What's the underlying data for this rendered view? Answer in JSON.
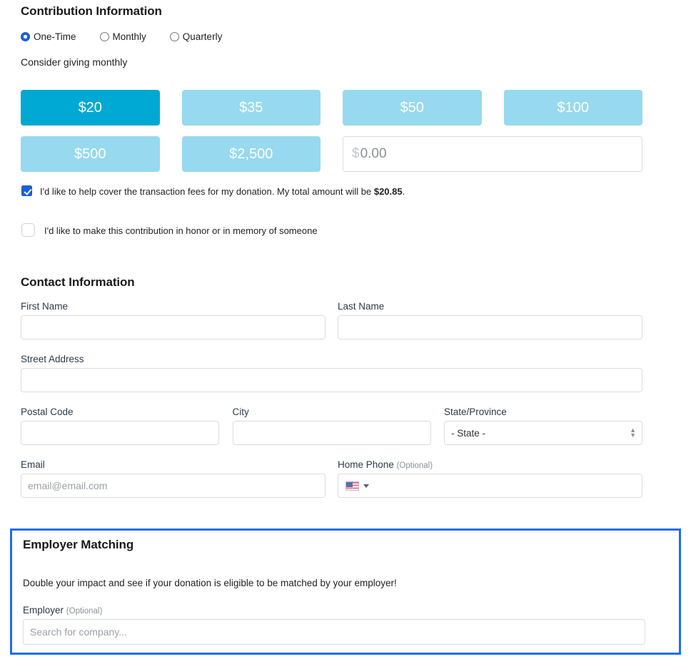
{
  "contribution": {
    "title": "Contribution Information",
    "frequency_options": [
      {
        "label": "One-Time",
        "selected": true
      },
      {
        "label": "Monthly",
        "selected": false
      },
      {
        "label": "Quarterly",
        "selected": false
      }
    ],
    "consider_text": "Consider giving monthly",
    "amounts": [
      {
        "label": "$20",
        "selected": true
      },
      {
        "label": "$35",
        "selected": false
      },
      {
        "label": "$50",
        "selected": false
      },
      {
        "label": "$100",
        "selected": false
      },
      {
        "label": "$500",
        "selected": false
      },
      {
        "label": "$2,500",
        "selected": false
      }
    ],
    "custom_amount": {
      "currency_symbol": "$",
      "value": "",
      "placeholder": "0.00"
    },
    "fee_checkbox": {
      "checked": true,
      "text_before": "I'd like to help cover the transaction fees for my donation. My total amount will be ",
      "total_amount": "$20.85",
      "text_after": "."
    },
    "honor_checkbox": {
      "checked": false,
      "label": "I'd like to make this contribution in honor or in memory of someone"
    }
  },
  "contact": {
    "title": "Contact Information",
    "first_name": {
      "label": "First Name",
      "value": "",
      "placeholder": ""
    },
    "last_name": {
      "label": "Last Name",
      "value": "",
      "placeholder": ""
    },
    "street_address": {
      "label": "Street Address",
      "value": "",
      "placeholder": ""
    },
    "postal_code": {
      "label": "Postal Code",
      "value": "",
      "placeholder": ""
    },
    "city": {
      "label": "City",
      "value": "",
      "placeholder": ""
    },
    "state": {
      "label": "State/Province",
      "selected": "- State -",
      "options": [
        "- State -"
      ]
    },
    "email": {
      "label": "Email",
      "value": "",
      "placeholder": "email@email.com"
    },
    "home_phone": {
      "label": "Home Phone",
      "optional": "(Optional)",
      "country_flag": "us-flag-icon",
      "value": "",
      "placeholder": ""
    }
  },
  "employer_matching": {
    "title": "Employer Matching",
    "description": "Double your impact and see if your donation is eligible to be matched by your employer!",
    "employer_field": {
      "label": "Employer",
      "optional": "(Optional)",
      "value": "",
      "placeholder": "Search for company..."
    },
    "highlight_color": "#1a6ef5"
  },
  "colors": {
    "amount_selected": "#00a9d4",
    "amount_default": "#97d9ee",
    "checkbox_blue": "#1a62d8",
    "focus_border": "#1a6ef5"
  }
}
